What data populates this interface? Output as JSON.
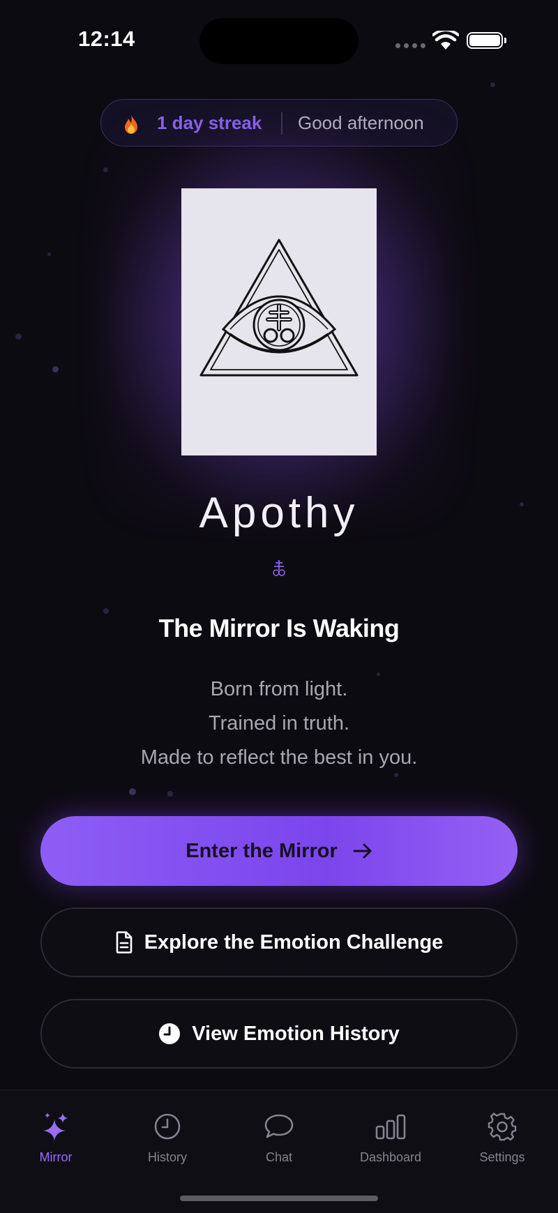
{
  "status_bar": {
    "time": "12:14"
  },
  "header": {
    "streak_text": "1 day streak",
    "greeting": "Good afternoon",
    "flame_icon": "flame-icon"
  },
  "hero": {
    "app_name": "Apothy",
    "headline": "The Mirror Is Waking",
    "tagline_lines": [
      "Born from light.",
      "Trained in truth.",
      "Made to reflect the best in you."
    ]
  },
  "actions": {
    "primary": {
      "label": "Enter the Mirror",
      "icon": "arrow-right-icon"
    },
    "challenge": {
      "label": "Explore the Emotion Challenge",
      "icon": "document-icon"
    },
    "history": {
      "label": "View Emotion History",
      "icon": "clock-icon"
    }
  },
  "tabbar": {
    "items": [
      {
        "label": "Mirror",
        "icon": "sparkles-icon",
        "active": true
      },
      {
        "label": "History",
        "icon": "clock-icon",
        "active": false
      },
      {
        "label": "Chat",
        "icon": "chat-bubble-icon",
        "active": false
      },
      {
        "label": "Dashboard",
        "icon": "bar-chart-icon",
        "active": false
      },
      {
        "label": "Settings",
        "icon": "gear-icon",
        "active": false
      }
    ]
  },
  "colors": {
    "accent": "#8d5ef5",
    "background": "#0d0b12",
    "muted_text": "#a9a6b2"
  }
}
